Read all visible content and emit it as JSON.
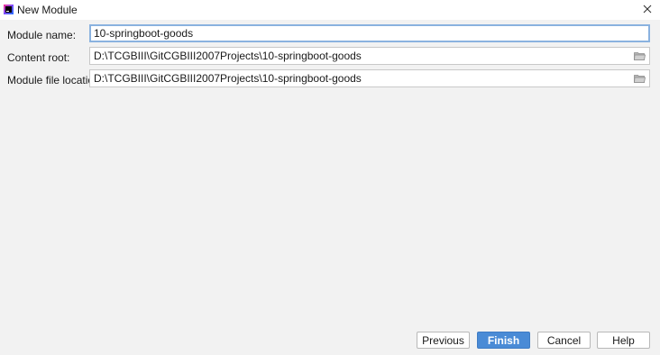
{
  "window": {
    "title": "New Module",
    "icon": "intellij-app-icon",
    "close_icon": "close-icon"
  },
  "form": {
    "module_name": {
      "label": "Module name:",
      "value": "10-springboot-goods"
    },
    "content_root": {
      "label": "Content root:",
      "value": "D:\\TCGBIII\\GitCGBIII2007Projects\\10-springboot-goods",
      "browse_icon": "folder-icon"
    },
    "module_file_location": {
      "label": "Module file location:",
      "value": "D:\\TCGBIII\\GitCGBIII2007Projects\\10-springboot-goods",
      "browse_icon": "folder-icon"
    }
  },
  "buttons": {
    "previous": "Previous",
    "finish": "Finish",
    "cancel": "Cancel",
    "help": "Help"
  },
  "colors": {
    "primary": "#4a8bd6",
    "focus_border": "#8ab2df",
    "dialog_bg": "#f2f2f2"
  }
}
